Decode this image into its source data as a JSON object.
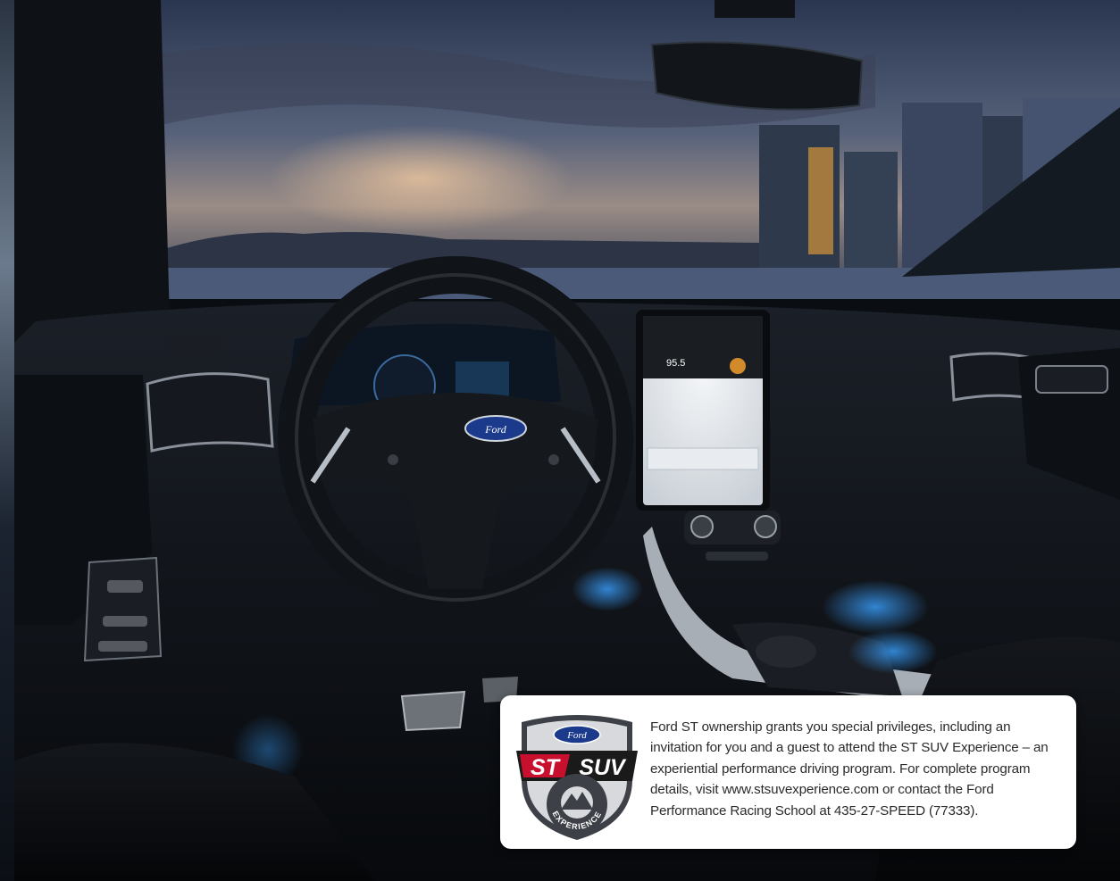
{
  "badge": {
    "brand": "Ford",
    "model_prefix": "ST",
    "model_suffix": "SUV",
    "arc_text": "EXPERIENCE"
  },
  "card": {
    "text": "Ford ST ownership grants you special privileges, including an invitation for you and a guest to attend the ST SUV Experience – an experiential performance driving program. For complete program details, visit www.stsuvexperience.com or contact the Ford Performance Racing School at 435-27-SPEED (77333)."
  },
  "infotainment": {
    "radio_frequency": "95.5"
  },
  "steering_wheel": {
    "logo": "Ford"
  },
  "colors": {
    "ambient_blue": "#3aa0ff",
    "badge_red": "#c8102e",
    "ford_blue": "#1b3a8c"
  }
}
